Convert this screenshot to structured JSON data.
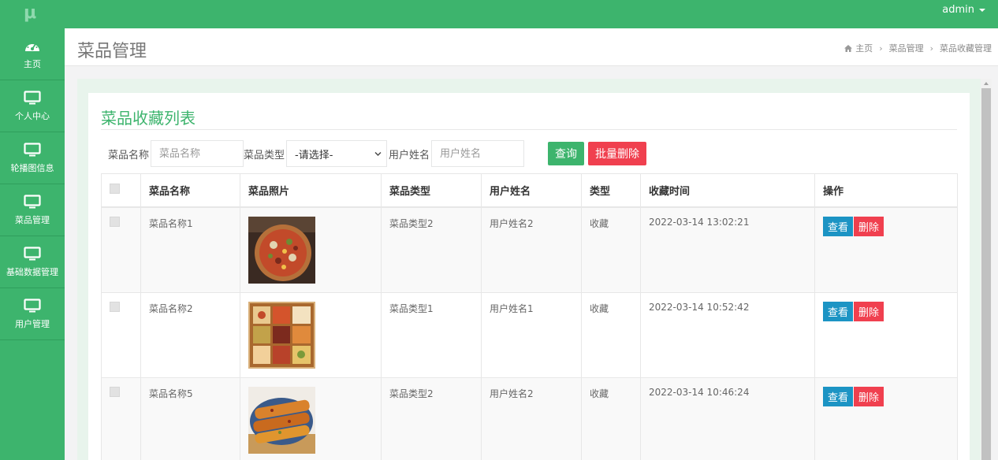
{
  "app": {
    "logo": "μ",
    "user": "admin"
  },
  "sidebar": {
    "items": [
      {
        "label": "主页",
        "icon": "dashboard-icon"
      },
      {
        "label": "个人中心",
        "icon": "monitor-icon"
      },
      {
        "label": "轮播图信息",
        "icon": "monitor-icon"
      },
      {
        "label": "菜品管理",
        "icon": "monitor-icon"
      },
      {
        "label": "基础数据管理",
        "icon": "monitor-icon"
      },
      {
        "label": "用户管理",
        "icon": "monitor-icon"
      }
    ]
  },
  "header": {
    "title": "菜品管理",
    "breadcrumb": [
      "主页",
      "菜品管理",
      "菜品收藏管理"
    ]
  },
  "panel": {
    "title": "菜品收藏列表"
  },
  "search": {
    "name_label": "菜品名称",
    "name_placeholder": "菜品名称",
    "type_label": "菜品类型",
    "type_selected": "-请选择-",
    "user_label": "用户姓名",
    "user_placeholder": "用户姓名",
    "query_label": "查询",
    "batch_delete_label": "批量删除"
  },
  "table": {
    "headers": [
      "菜品名称",
      "菜品照片",
      "菜品类型",
      "用户姓名",
      "类型",
      "收藏时间",
      "操作"
    ],
    "rows": [
      {
        "name": "菜品名称1",
        "photo": "pizza-photo",
        "type": "菜品类型2",
        "user": "用户姓名2",
        "kind": "收藏",
        "time": "2022-03-14 13:02:21"
      },
      {
        "name": "菜品名称2",
        "photo": "bento-photo",
        "type": "菜品类型1",
        "user": "用户姓名1",
        "kind": "收藏",
        "time": "2022-03-14 10:52:42"
      },
      {
        "name": "菜品名称5",
        "photo": "fried-rolls-photo",
        "type": "菜品类型2",
        "user": "用户姓名2",
        "kind": "收藏",
        "time": "2022-03-14 10:46:24"
      }
    ],
    "view_label": "查看",
    "delete_label": "删除"
  },
  "colors": {
    "brand": "#3db46d",
    "danger": "#f0404f",
    "info": "#1c94c4"
  }
}
